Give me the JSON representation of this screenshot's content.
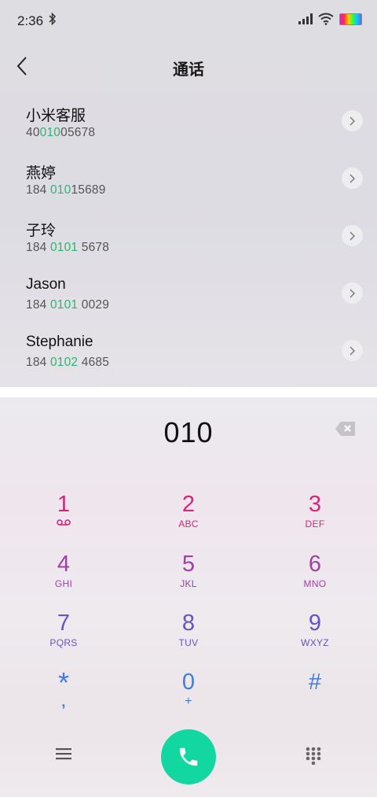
{
  "status_bar": {
    "time": "2:36",
    "icons": [
      "bluetooth-icon",
      "signal-icon",
      "wifi-icon",
      "battery-icon"
    ]
  },
  "header": {
    "title": "通话",
    "back_icon": "chevron-left-icon"
  },
  "contacts": [
    {
      "name": "小米客服",
      "number_before": "40",
      "number_match": "010",
      "number_after": "05678"
    },
    {
      "name": "燕婷",
      "number_before": "184 ",
      "number_match": "010",
      "number_after": "15689"
    },
    {
      "name": "子玲",
      "number_before": "184 ",
      "number_match": "0101",
      "number_after": " 5678"
    },
    {
      "name": "Jason",
      "number_before": "184 ",
      "number_match": "0101",
      "number_after": " 0029"
    },
    {
      "name": "Stephanie",
      "number_before": "184 ",
      "number_match": "0102",
      "number_after": " 4685"
    }
  ],
  "dialer": {
    "entered_digits": "010",
    "keys": [
      {
        "digit": "1",
        "letters": "",
        "icon": "voicemail-icon"
      },
      {
        "digit": "2",
        "letters": "ABC"
      },
      {
        "digit": "3",
        "letters": "DEF"
      },
      {
        "digit": "4",
        "letters": "GHI"
      },
      {
        "digit": "5",
        "letters": "JKL"
      },
      {
        "digit": "6",
        "letters": "MNO"
      },
      {
        "digit": "7",
        "letters": "PQRS"
      },
      {
        "digit": "8",
        "letters": "TUV"
      },
      {
        "digit": "9",
        "letters": "WXYZ"
      },
      {
        "digit": "*",
        "letters": ","
      },
      {
        "digit": "0",
        "letters": "+"
      },
      {
        "digit": "#",
        "letters": ""
      }
    ],
    "bottom_icons": [
      "menu-icon",
      "phone-icon",
      "dialpad-icon"
    ]
  },
  "colors": {
    "row1": "#d6267c",
    "row2": "#a03fa8",
    "row3": "#6454c6",
    "row4": "#3f7ce0",
    "match_highlight": "#2bb673",
    "call_button": "#12d7a1"
  }
}
